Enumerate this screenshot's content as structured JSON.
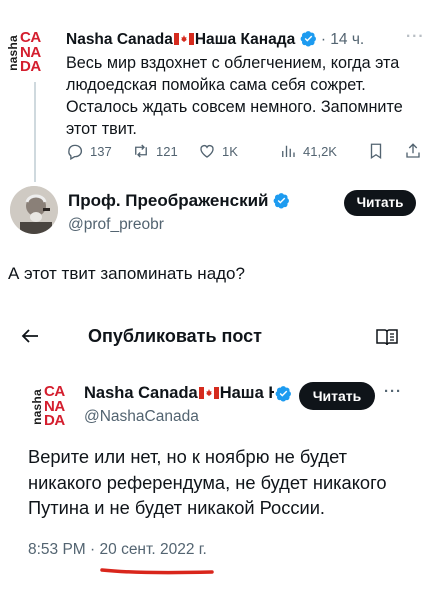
{
  "logo": {
    "side": "nasha",
    "lines": [
      "CA",
      "NA",
      "DA"
    ]
  },
  "quoted_tweet": {
    "author_name": "Nasha Canada",
    "author_name_ru": "Наша Канада",
    "time": "· 14 ч.",
    "more": "···",
    "text": "Весь мир вздохнет с облегчением, когда эта людоедская помойка сама себя сожрет. Осталось ждать совсем немного. Запомните этот твит.",
    "replies": "137",
    "retweets": "121",
    "likes": "1K",
    "views": "41,2K"
  },
  "reply_author": {
    "name": "Проф. Преображенский",
    "handle": "@prof_preobr",
    "follow_label": "Читать"
  },
  "reply_text": "А этот твит запоминать надо?",
  "nav": {
    "title": "Опубликовать пост"
  },
  "main_tweet": {
    "author_name": "Nasha Canada",
    "author_name_ru": "Наша Н",
    "handle": "@NashaCanada",
    "follow_label": "Читать",
    "more": "···",
    "text": "Верите или нет, но к ноябрю не будет никакого референдума, не будет никакого Путина и не будет никакой России.",
    "time": "8:53 PM",
    "date": "20 сент. 2022 г."
  },
  "colors": {
    "verified": "#1d9bf0",
    "logo_red": "#d41e2e",
    "underline": "#d9261c",
    "text_primary": "#0f1419",
    "text_secondary": "#536471"
  }
}
